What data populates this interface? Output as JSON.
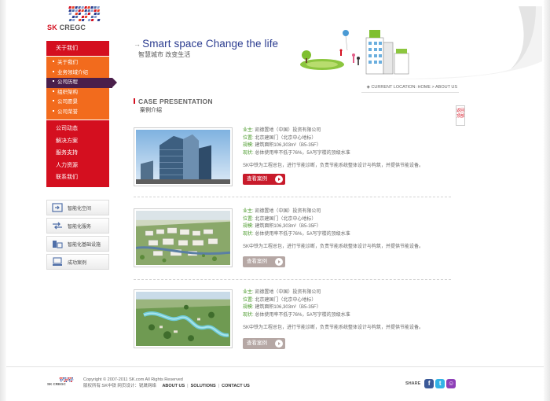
{
  "brand": {
    "logo_text_sk": "SK",
    "logo_text_rest": " CREGC",
    "footer_logo_text": "SK CREGC",
    "colors": {
      "red": "#d40f1f",
      "orange": "#f26b1d",
      "purple": "#4a1f4b",
      "navy": "#2a3b8f"
    }
  },
  "banner": {
    "tagline_en": "Smart space Change the life",
    "tagline_cn": "智慧城市 改变生活",
    "breadcrumb": "CURRENT LOCATION: HOME > ABOUT US"
  },
  "sidebar": {
    "header": "关于我们",
    "sub_items": [
      {
        "label": "关于我们"
      },
      {
        "label": "业务领域介绍"
      },
      {
        "label": "公司历程"
      },
      {
        "label": "组织架构"
      },
      {
        "label": "公司愿景"
      },
      {
        "label": "公司荣誉"
      }
    ],
    "active_sub_index": 2,
    "main_items": [
      {
        "label": "公司动态"
      },
      {
        "label": "解决方案"
      },
      {
        "label": "服务支持"
      },
      {
        "label": "人力资源"
      },
      {
        "label": "联系我们"
      }
    ],
    "features": [
      {
        "label": "智能化空间",
        "icon": "smart-space-icon"
      },
      {
        "label": "智能化服务",
        "icon": "smart-service-icon"
      },
      {
        "label": "智能化基础设施",
        "icon": "infrastructure-icon"
      },
      {
        "label": "成功案例",
        "icon": "success-case-icon"
      }
    ]
  },
  "section": {
    "title_en": "CASE PRESENTATION",
    "title_cn": "案例介绍",
    "side_tab": "返回顶部"
  },
  "cases": [
    {
      "owner_label": "业主:",
      "owner": "凯德置地（中国）投资有限公司",
      "location_label": "位置:",
      "location": "北京建国门（北京中心地标）",
      "scale_label": "规模:",
      "scale": "建筑面积106,303m²（B5-35F）",
      "status_label": "现状:",
      "status": "总体使用率不低于76%，5A写字楼的顶级水准",
      "description": "SK中铁为工程总包，进行节能诊断，负责节能系统整体设计与构筑，并提供节能设备。",
      "button": "查看案例",
      "button_style": "red"
    },
    {
      "owner_label": "业主:",
      "owner": "凯德置地（中国）投资有限公司",
      "location_label": "位置:",
      "location": "北京建国门（北京中心地标）",
      "scale_label": "规模:",
      "scale": "建筑面积106,303m²（B5-35F）",
      "status_label": "现状:",
      "status": "总体使用率不低于76%，5A写字楼的顶级水准",
      "description": "SK中铁为工程总包，进行节能诊断，负责节能系统整体设计与构筑，并提供节能设备。",
      "button": "查看案例",
      "button_style": "grey"
    },
    {
      "owner_label": "业主:",
      "owner": "凯德置地（中国）投资有限公司",
      "location_label": "位置:",
      "location": "北京建国门（北京中心地标）",
      "scale_label": "规模:",
      "scale": "建筑面积106,303m²（B5-35F）",
      "status_label": "现状:",
      "status": "总体使用率不低于76%，5A写字楼的顶级水准",
      "description": "SK中铁为工程总包，进行节能诊断，负责节能系统整体设计与构筑，并提供节能设备。",
      "button": "查看案例",
      "button_style": "grey"
    }
  ],
  "footer": {
    "copyright": "Copyright © 2007-2011 SK.com All Rights Reserved",
    "credits": "版权所有:SK中铁  网页设计：锐晟网络",
    "links": [
      {
        "label": "ABOUT US"
      },
      {
        "label": "SOLUTIONS"
      },
      {
        "label": "CONTACT US"
      }
    ],
    "share_label": "SHARE",
    "share_buttons": [
      {
        "icon": "facebook-icon",
        "glyph": "f",
        "color": "#3b5998"
      },
      {
        "icon": "twitter-icon",
        "glyph": "t",
        "color": "#33b3e6"
      },
      {
        "icon": "myspace-icon",
        "glyph": "☺",
        "color": "#8e3fb8"
      }
    ]
  }
}
